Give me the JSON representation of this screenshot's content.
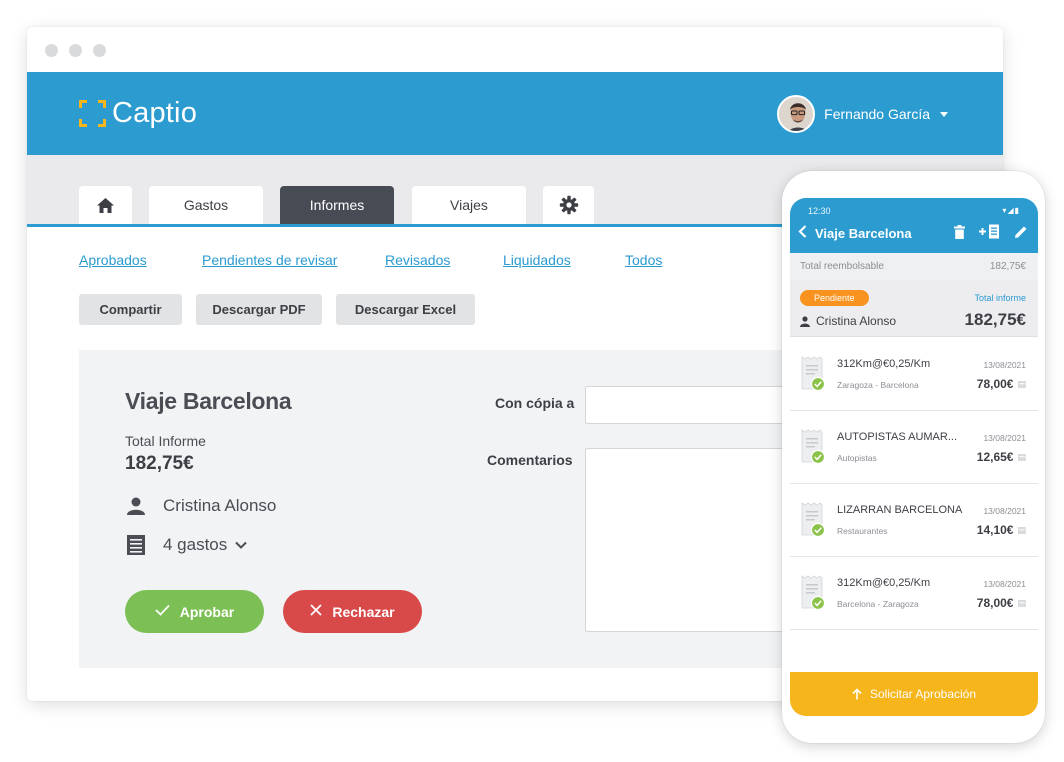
{
  "app": {
    "brand": "Captio"
  },
  "user": {
    "name": "Fernando García"
  },
  "tabs": {
    "gastos": "Gastos",
    "informes": "Informes",
    "viajes": "Viajes"
  },
  "filters": [
    "Aprobados",
    "Pendientes de revisar",
    "Revisados",
    "Liquidados",
    "Todos"
  ],
  "actions": {
    "share": "Compartir",
    "pdf": "Descargar PDF",
    "excel": "Descargar Excel"
  },
  "report": {
    "title": "Viaje Barcelona",
    "total_label": "Total Informe",
    "total_value": "182,75€",
    "owner": "Cristina Alonso",
    "expenses_count": "4 gastos",
    "approve": "Aprobar",
    "reject": "Rechazar",
    "cc_label": "Con cópia a",
    "comments_label": "Comentarios"
  },
  "phone": {
    "time": "12:30",
    "title": "Viaje Barcelona",
    "reimbursable_label": "Total reembolsable",
    "reimbursable_value": "182,75€",
    "status": "Pendiente",
    "total_label": "Total informe",
    "user": "Cristina Alonso",
    "total_value": "182,75€",
    "expenses": [
      {
        "title": "312Km@€0,25/Km",
        "category": "Zaragoza - Barcelona",
        "date": "13/08/2021",
        "amount": "78,00€"
      },
      {
        "title": "AUTOPISTAS AUMAR...",
        "category": "Autopistas",
        "date": "13/08/2021",
        "amount": "12,65€"
      },
      {
        "title": "LIZARRAN BARCELONA",
        "category": "Restaurantes",
        "date": "13/08/2021",
        "amount": "14,10€"
      },
      {
        "title": "312Km@€0,25/Km",
        "category": "Barcelona - Zaragoza",
        "date": "13/08/2021",
        "amount": "78,00€"
      }
    ],
    "cta": "Solicitar Aprobación"
  },
  "colors": {
    "brand_blue": "#2b9bd0",
    "accent_yellow": "#f6b51b",
    "approve_green": "#7cc055",
    "reject_red": "#d84a4a",
    "pending_orange": "#f7931e"
  },
  "icons": [
    "home-icon",
    "gear-icon",
    "user-icon",
    "receipt-list-icon",
    "chevron-down-icon",
    "check-icon",
    "close-icon",
    "back-arrow-icon",
    "trash-icon",
    "add-receipt-icon",
    "edit-icon",
    "arrow-up-icon"
  ]
}
